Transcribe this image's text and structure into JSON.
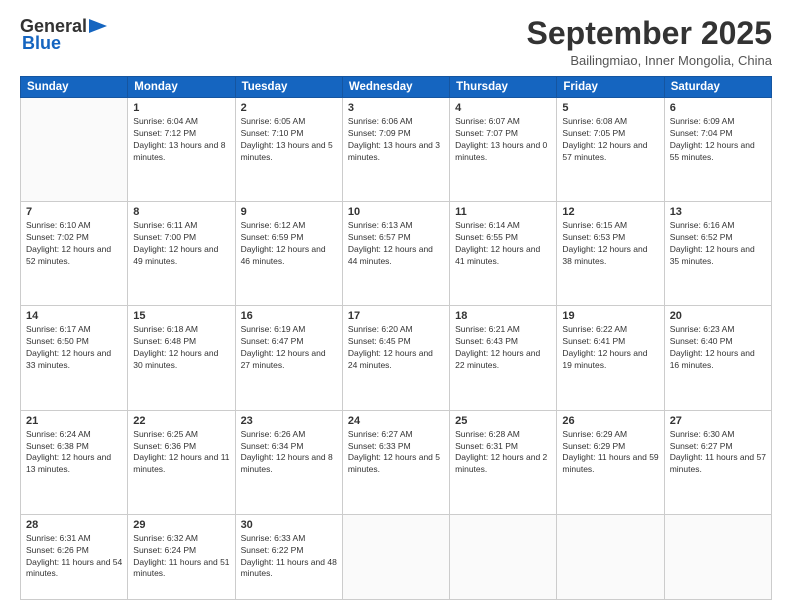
{
  "logo": {
    "general": "General",
    "blue": "Blue"
  },
  "header": {
    "month": "September 2025",
    "location": "Bailingmiao, Inner Mongolia, China"
  },
  "weekdays": [
    "Sunday",
    "Monday",
    "Tuesday",
    "Wednesday",
    "Thursday",
    "Friday",
    "Saturday"
  ],
  "weeks": [
    [
      {
        "day": "",
        "sunrise": "",
        "sunset": "",
        "daylight": ""
      },
      {
        "day": "1",
        "sunrise": "Sunrise: 6:04 AM",
        "sunset": "Sunset: 7:12 PM",
        "daylight": "Daylight: 13 hours and 8 minutes."
      },
      {
        "day": "2",
        "sunrise": "Sunrise: 6:05 AM",
        "sunset": "Sunset: 7:10 PM",
        "daylight": "Daylight: 13 hours and 5 minutes."
      },
      {
        "day": "3",
        "sunrise": "Sunrise: 6:06 AM",
        "sunset": "Sunset: 7:09 PM",
        "daylight": "Daylight: 13 hours and 3 minutes."
      },
      {
        "day": "4",
        "sunrise": "Sunrise: 6:07 AM",
        "sunset": "Sunset: 7:07 PM",
        "daylight": "Daylight: 13 hours and 0 minutes."
      },
      {
        "day": "5",
        "sunrise": "Sunrise: 6:08 AM",
        "sunset": "Sunset: 7:05 PM",
        "daylight": "Daylight: 12 hours and 57 minutes."
      },
      {
        "day": "6",
        "sunrise": "Sunrise: 6:09 AM",
        "sunset": "Sunset: 7:04 PM",
        "daylight": "Daylight: 12 hours and 55 minutes."
      }
    ],
    [
      {
        "day": "7",
        "sunrise": "Sunrise: 6:10 AM",
        "sunset": "Sunset: 7:02 PM",
        "daylight": "Daylight: 12 hours and 52 minutes."
      },
      {
        "day": "8",
        "sunrise": "Sunrise: 6:11 AM",
        "sunset": "Sunset: 7:00 PM",
        "daylight": "Daylight: 12 hours and 49 minutes."
      },
      {
        "day": "9",
        "sunrise": "Sunrise: 6:12 AM",
        "sunset": "Sunset: 6:59 PM",
        "daylight": "Daylight: 12 hours and 46 minutes."
      },
      {
        "day": "10",
        "sunrise": "Sunrise: 6:13 AM",
        "sunset": "Sunset: 6:57 PM",
        "daylight": "Daylight: 12 hours and 44 minutes."
      },
      {
        "day": "11",
        "sunrise": "Sunrise: 6:14 AM",
        "sunset": "Sunset: 6:55 PM",
        "daylight": "Daylight: 12 hours and 41 minutes."
      },
      {
        "day": "12",
        "sunrise": "Sunrise: 6:15 AM",
        "sunset": "Sunset: 6:53 PM",
        "daylight": "Daylight: 12 hours and 38 minutes."
      },
      {
        "day": "13",
        "sunrise": "Sunrise: 6:16 AM",
        "sunset": "Sunset: 6:52 PM",
        "daylight": "Daylight: 12 hours and 35 minutes."
      }
    ],
    [
      {
        "day": "14",
        "sunrise": "Sunrise: 6:17 AM",
        "sunset": "Sunset: 6:50 PM",
        "daylight": "Daylight: 12 hours and 33 minutes."
      },
      {
        "day": "15",
        "sunrise": "Sunrise: 6:18 AM",
        "sunset": "Sunset: 6:48 PM",
        "daylight": "Daylight: 12 hours and 30 minutes."
      },
      {
        "day": "16",
        "sunrise": "Sunrise: 6:19 AM",
        "sunset": "Sunset: 6:47 PM",
        "daylight": "Daylight: 12 hours and 27 minutes."
      },
      {
        "day": "17",
        "sunrise": "Sunrise: 6:20 AM",
        "sunset": "Sunset: 6:45 PM",
        "daylight": "Daylight: 12 hours and 24 minutes."
      },
      {
        "day": "18",
        "sunrise": "Sunrise: 6:21 AM",
        "sunset": "Sunset: 6:43 PM",
        "daylight": "Daylight: 12 hours and 22 minutes."
      },
      {
        "day": "19",
        "sunrise": "Sunrise: 6:22 AM",
        "sunset": "Sunset: 6:41 PM",
        "daylight": "Daylight: 12 hours and 19 minutes."
      },
      {
        "day": "20",
        "sunrise": "Sunrise: 6:23 AM",
        "sunset": "Sunset: 6:40 PM",
        "daylight": "Daylight: 12 hours and 16 minutes."
      }
    ],
    [
      {
        "day": "21",
        "sunrise": "Sunrise: 6:24 AM",
        "sunset": "Sunset: 6:38 PM",
        "daylight": "Daylight: 12 hours and 13 minutes."
      },
      {
        "day": "22",
        "sunrise": "Sunrise: 6:25 AM",
        "sunset": "Sunset: 6:36 PM",
        "daylight": "Daylight: 12 hours and 11 minutes."
      },
      {
        "day": "23",
        "sunrise": "Sunrise: 6:26 AM",
        "sunset": "Sunset: 6:34 PM",
        "daylight": "Daylight: 12 hours and 8 minutes."
      },
      {
        "day": "24",
        "sunrise": "Sunrise: 6:27 AM",
        "sunset": "Sunset: 6:33 PM",
        "daylight": "Daylight: 12 hours and 5 minutes."
      },
      {
        "day": "25",
        "sunrise": "Sunrise: 6:28 AM",
        "sunset": "Sunset: 6:31 PM",
        "daylight": "Daylight: 12 hours and 2 minutes."
      },
      {
        "day": "26",
        "sunrise": "Sunrise: 6:29 AM",
        "sunset": "Sunset: 6:29 PM",
        "daylight": "Daylight: 11 hours and 59 minutes."
      },
      {
        "day": "27",
        "sunrise": "Sunrise: 6:30 AM",
        "sunset": "Sunset: 6:27 PM",
        "daylight": "Daylight: 11 hours and 57 minutes."
      }
    ],
    [
      {
        "day": "28",
        "sunrise": "Sunrise: 6:31 AM",
        "sunset": "Sunset: 6:26 PM",
        "daylight": "Daylight: 11 hours and 54 minutes."
      },
      {
        "day": "29",
        "sunrise": "Sunrise: 6:32 AM",
        "sunset": "Sunset: 6:24 PM",
        "daylight": "Daylight: 11 hours and 51 minutes."
      },
      {
        "day": "30",
        "sunrise": "Sunrise: 6:33 AM",
        "sunset": "Sunset: 6:22 PM",
        "daylight": "Daylight: 11 hours and 48 minutes."
      },
      {
        "day": "",
        "sunrise": "",
        "sunset": "",
        "daylight": ""
      },
      {
        "day": "",
        "sunrise": "",
        "sunset": "",
        "daylight": ""
      },
      {
        "day": "",
        "sunrise": "",
        "sunset": "",
        "daylight": ""
      },
      {
        "day": "",
        "sunrise": "",
        "sunset": "",
        "daylight": ""
      }
    ]
  ]
}
